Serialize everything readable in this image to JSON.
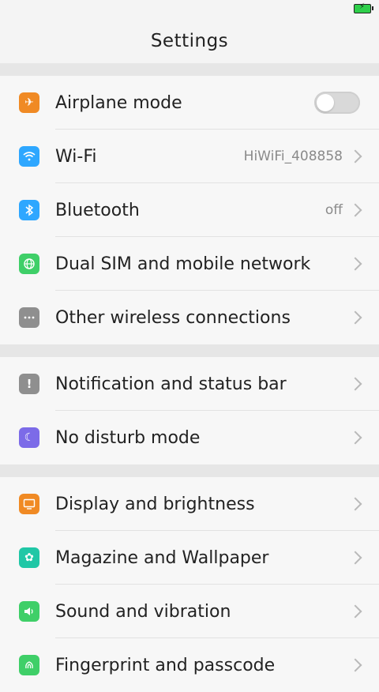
{
  "header": {
    "title": "Settings"
  },
  "sections": [
    {
      "items": [
        {
          "label": "Airplane mode",
          "icon": "airplane-icon",
          "color": "#f08a24",
          "control": "toggle",
          "toggle_state": false
        },
        {
          "label": "Wi-Fi",
          "icon": "wifi-icon",
          "color": "#2ea7ff",
          "value": "HiWiFi_408858"
        },
        {
          "label": "Bluetooth",
          "icon": "bluetooth-icon",
          "color": "#2ea7ff",
          "value": "off"
        },
        {
          "label": "Dual SIM and mobile network",
          "icon": "globe-icon",
          "color": "#3fcf68"
        },
        {
          "label": "Other wireless connections",
          "icon": "more-icon",
          "color": "#8f8f8f"
        }
      ]
    },
    {
      "items": [
        {
          "label": "Notification and status bar",
          "icon": "notification-icon",
          "color": "#8f8f8f"
        },
        {
          "label": "No disturb mode",
          "icon": "moon-icon",
          "color": "#7c6be8"
        }
      ]
    },
    {
      "items": [
        {
          "label": "Display and brightness",
          "icon": "display-icon",
          "color": "#f08a24"
        },
        {
          "label": "Magazine and Wallpaper",
          "icon": "flower-icon",
          "color": "#20c7a6"
        },
        {
          "label": "Sound and vibration",
          "icon": "speaker-icon",
          "color": "#3fcf68"
        },
        {
          "label": "Fingerprint and passcode",
          "icon": "fingerprint-icon",
          "color": "#3fcf68"
        }
      ]
    }
  ],
  "battery": {
    "color": "#2ecf4a"
  }
}
